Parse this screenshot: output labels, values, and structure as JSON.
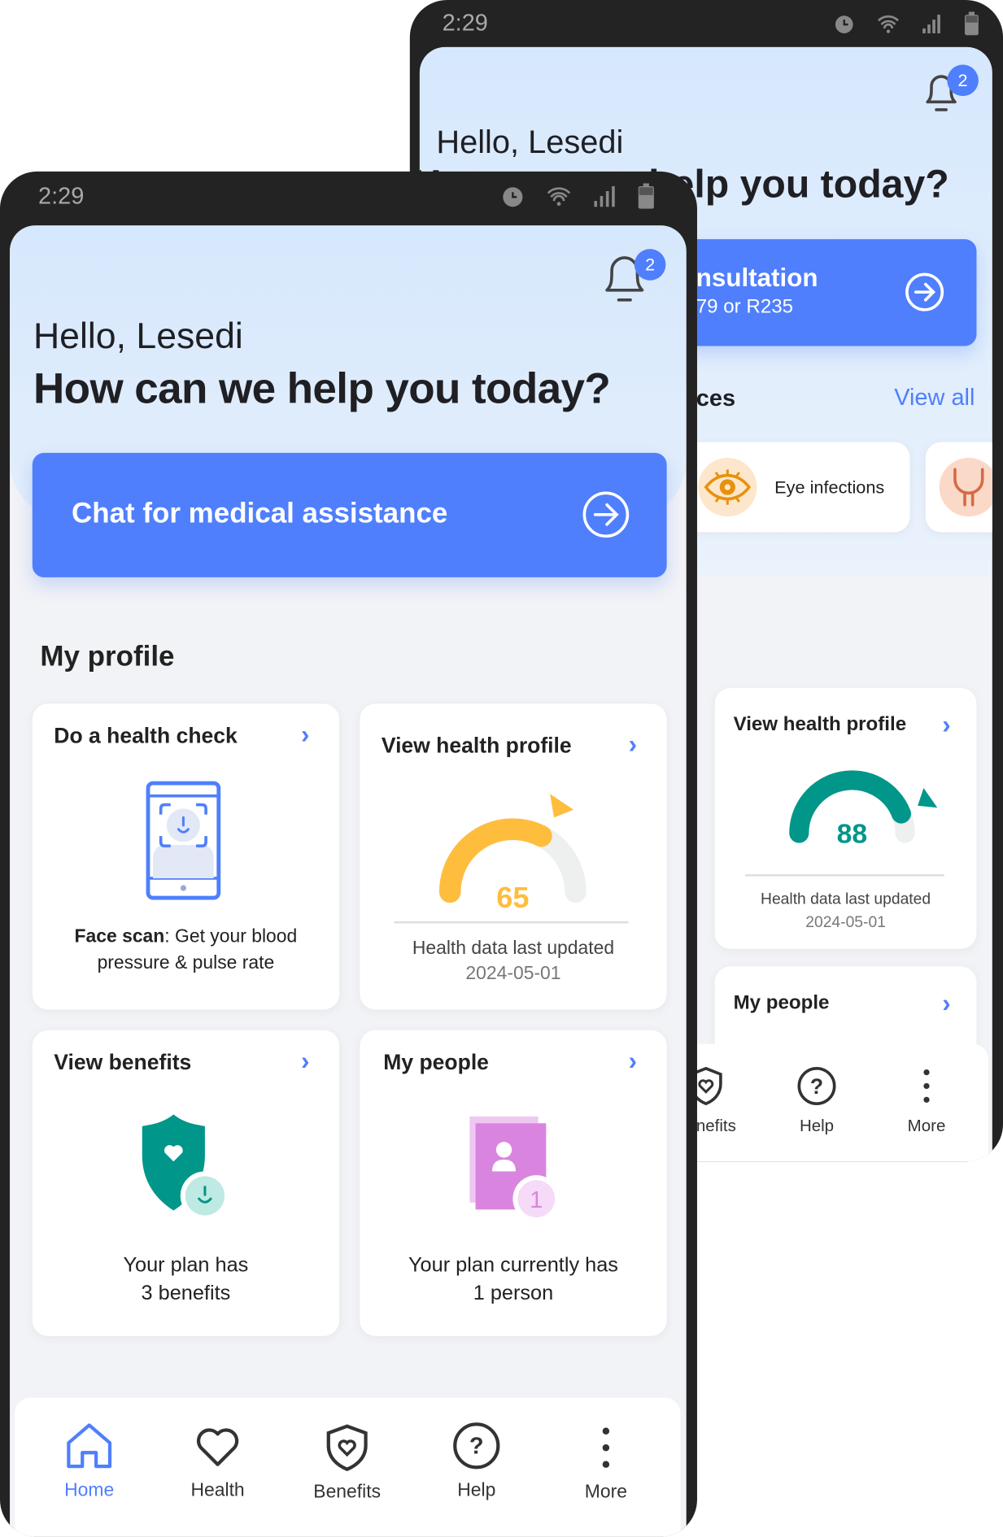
{
  "back_phone": {
    "status_time": "2:29",
    "notification_count": "2",
    "greeting": "Hello, Lesedi",
    "headline": "How can we help you today?",
    "consult_title_fragment": "nsultation",
    "consult_price_fragment": "79 or R235",
    "section_fragment": "ces",
    "view_all": "View all",
    "conditions": [
      {
        "label": "Eye infections",
        "icon": "eye-icon"
      },
      {
        "label": "",
        "icon": "bladder-icon"
      }
    ],
    "health_profile": {
      "title": "View health profile",
      "score": "88",
      "score_value": 88,
      "updated_label": "Health data last updated",
      "updated_date": "2024-05-01",
      "color": "#00968a"
    },
    "my_people": {
      "title": "My people"
    },
    "nav": [
      {
        "label": "Benefits",
        "icon": "shield-heart-icon"
      },
      {
        "label": "Help",
        "icon": "help-icon"
      },
      {
        "label": "More",
        "icon": "more-vertical-icon"
      }
    ]
  },
  "front_phone": {
    "status_time": "2:29",
    "notification_count": "2",
    "greeting": "Hello, Lesedi",
    "headline": "How can we help you today?",
    "chat_button": "Chat for medical assistance",
    "section_title": "My profile",
    "cards": {
      "health_check": {
        "title": "Do a health check",
        "text_bold": "Face scan",
        "text": ": Get your blood pressure & pulse rate"
      },
      "health_profile": {
        "title": "View health profile",
        "score": "65",
        "score_value": 65,
        "updated_label": "Health data last updated",
        "updated_date": "2024-05-01",
        "color": "#ffbd3e"
      },
      "benefits": {
        "title": "View benefits",
        "line1": "Your plan has",
        "line2": "3 benefits"
      },
      "people": {
        "title": "My people",
        "count": "1",
        "line1": "Your plan currently has",
        "line2": "1 person"
      }
    },
    "nav": [
      {
        "label": "Home",
        "icon": "home-icon",
        "active": true
      },
      {
        "label": "Health",
        "icon": "heart-icon"
      },
      {
        "label": "Benefits",
        "icon": "shield-heart-icon"
      },
      {
        "label": "Help",
        "icon": "help-icon"
      },
      {
        "label": "More",
        "icon": "more-vertical-icon"
      }
    ]
  },
  "colors": {
    "accent": "#4f7ffc",
    "frame": "#232323",
    "header": "#d6e8fd"
  }
}
